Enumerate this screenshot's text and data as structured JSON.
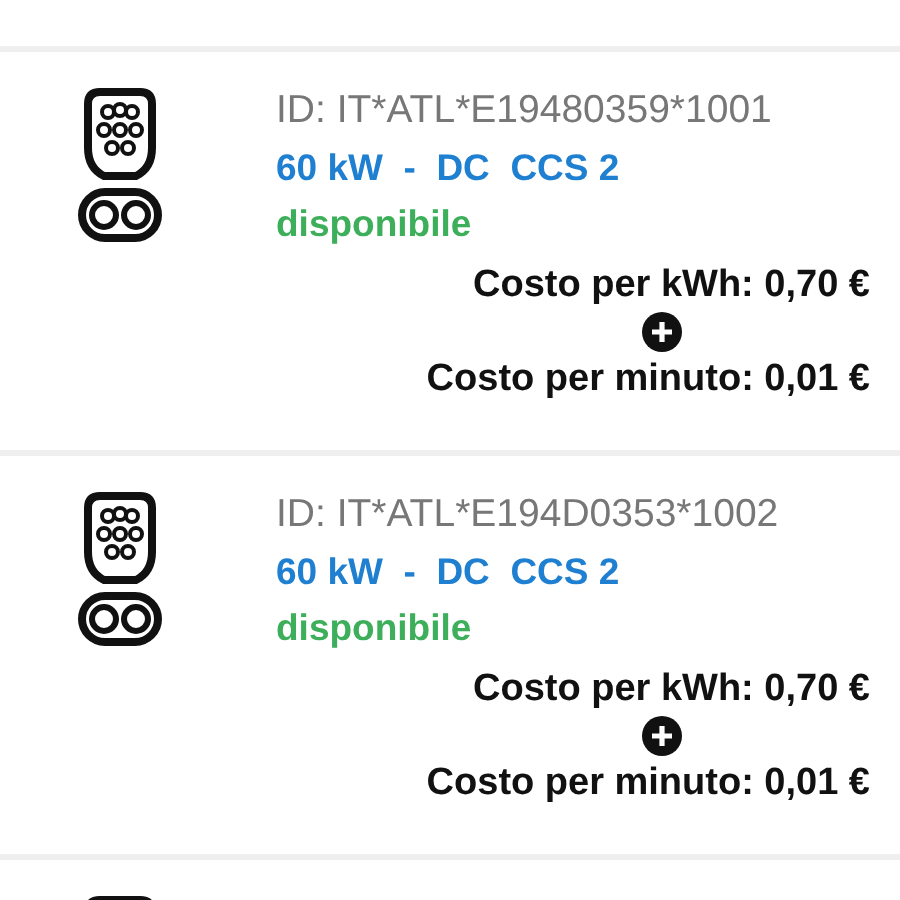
{
  "connectors": [
    {
      "id": "ID: IT*ATL*E19480359*1001",
      "power": "60 kW  -  DC  CCS 2",
      "status": "disponibile",
      "costs": [
        "Costo per kWh: 0,70 €",
        "Costo per minuto: 0,01 €"
      ]
    },
    {
      "id": "ID: IT*ATL*E194D0353*1002",
      "power": "60 kW  -  DC  CCS 2",
      "status": "disponibile",
      "costs": [
        "Costo per kWh: 0,70 €",
        "Costo per minuto: 0,01 €"
      ]
    }
  ]
}
